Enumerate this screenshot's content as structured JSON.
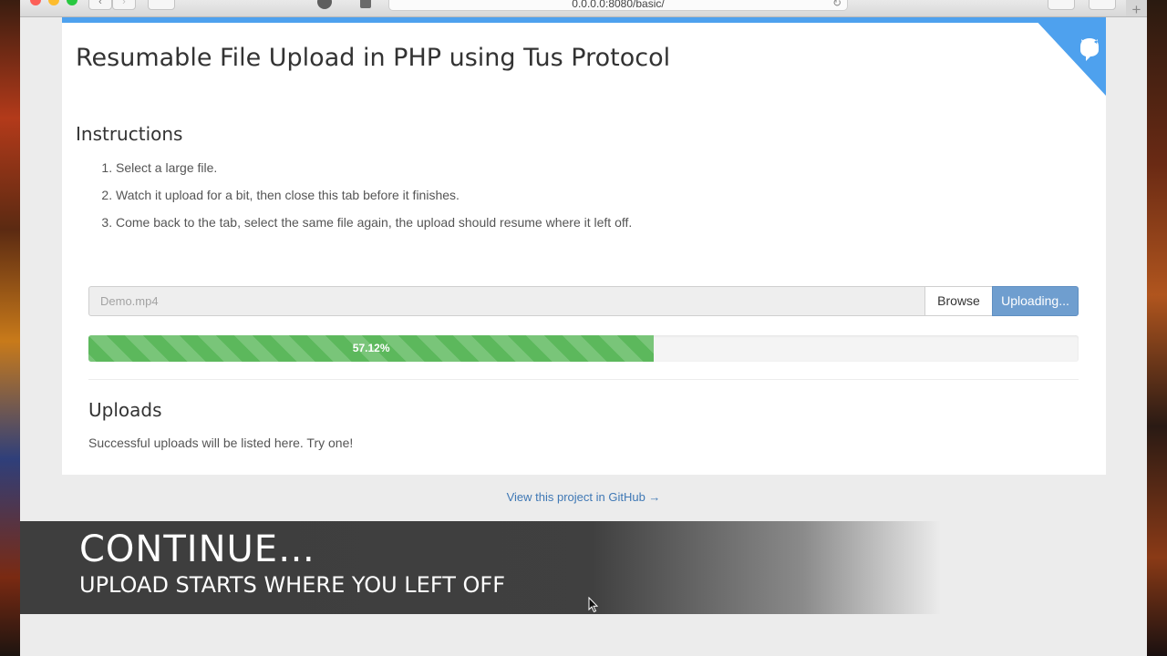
{
  "browser": {
    "url": "0.0.0.0:8080/basic/",
    "new_tab_symbol": "+",
    "reload_symbol": "↻",
    "back_symbol": "‹",
    "forward_symbol": "›"
  },
  "page": {
    "title": "Resumable File Upload in PHP using Tus Protocol",
    "instructions_heading": "Instructions",
    "steps": [
      "Select a large file.",
      "Watch it upload for a bit, then close this tab before it finishes.",
      "Come back to the tab, select the same file again, the upload should resume where it left off."
    ],
    "file_input": {
      "placeholder": "Demo.mp4"
    },
    "browse_label": "Browse",
    "upload_label": "Uploading...",
    "progress": {
      "percent": 57.12,
      "label": "57.12%"
    },
    "uploads_heading": "Uploads",
    "uploads_message": "Successful uploads will be listed here. Try one!",
    "github_link": "View this project in GitHub →"
  },
  "overlay": {
    "title": "CONTINUE…",
    "subtitle": "UPLOAD STARTS WHERE YOU LEFT OFF"
  },
  "colors": {
    "accent_blue": "#4ea1ee",
    "progress_green": "#5cb85c",
    "upload_button": "#6f9ecf",
    "link": "#3f78b5"
  }
}
